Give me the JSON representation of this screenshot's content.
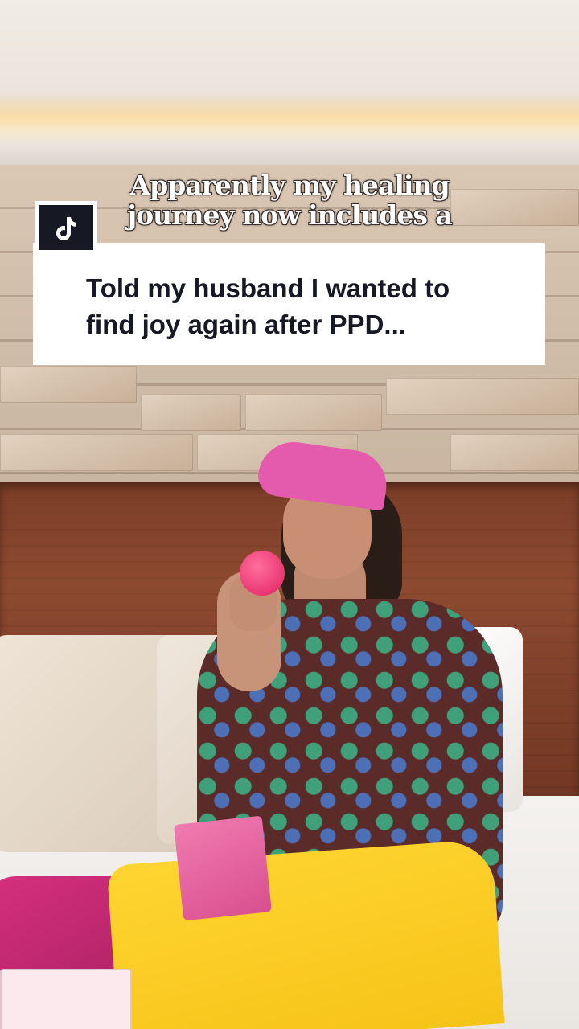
{
  "overlay": {
    "caption_lines": [
      "Apparently my healing",
      "journey now includes a"
    ],
    "comment_card": {
      "lines": [
        "Told my husband I wanted to",
        "find joy again after PPD..."
      ]
    },
    "badge_icon": "tiktok-logo-icon"
  },
  "colors": {
    "card_bg": "#ffffff",
    "card_text": "#161823",
    "badge_bg": "#161823",
    "cap": "#e45bae",
    "tote": "#ffd531"
  }
}
